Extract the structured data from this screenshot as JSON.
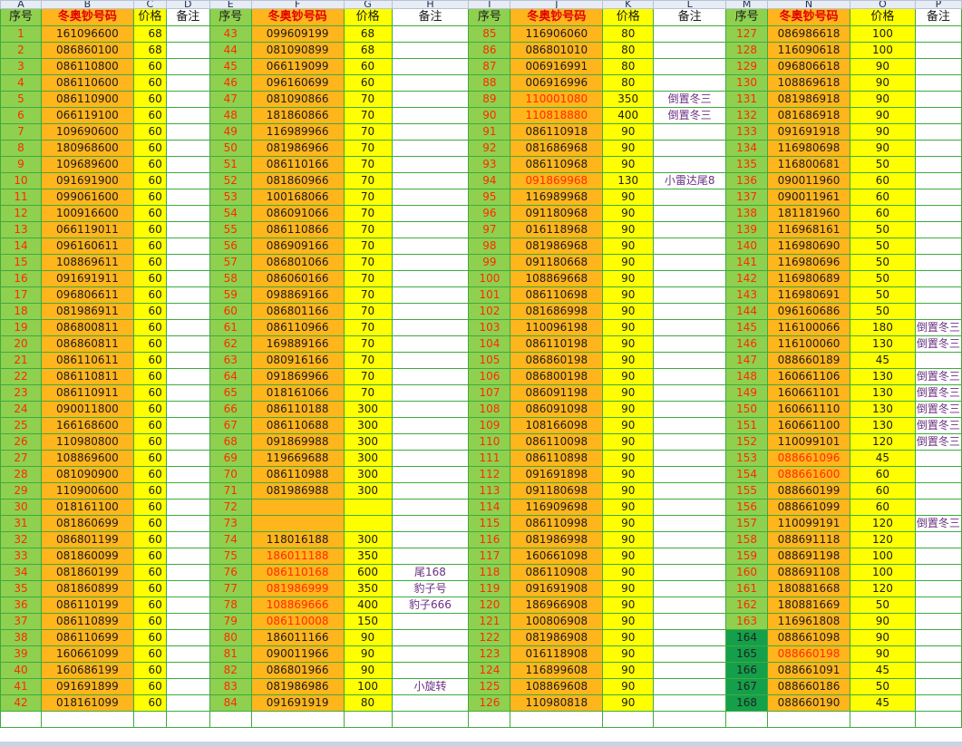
{
  "colors": {
    "seq": "#8fd04f",
    "code": "#ffb51c",
    "price": "#ffff00",
    "note": "#ffffff",
    "seq_dark": "#14a04a",
    "red_text": "#ff2a00",
    "purple_text": "#6a3080"
  },
  "column_letters": [
    "A",
    "B",
    "C",
    "D",
    "E",
    "F",
    "G",
    "H",
    "I",
    "J",
    "K",
    "L",
    "M",
    "N",
    "O",
    "P"
  ],
  "headers": [
    "序号",
    "冬奥钞号码",
    "价格",
    "备注",
    "序号",
    "冬奥钞号码",
    "价格",
    "备注",
    "序号",
    "冬奥钞号码",
    "价格",
    "备注",
    "序号",
    "冬奥钞号码",
    "价格",
    "备注"
  ],
  "rows": [
    [
      "1",
      "161096600",
      "68",
      "",
      "43",
      "099609199",
      "68",
      "",
      "85",
      "116906060",
      "80",
      "",
      "127",
      "086986618",
      "100",
      ""
    ],
    [
      "2",
      "086860100",
      "68",
      "",
      "44",
      "081090899",
      "68",
      "",
      "86",
      "086801010",
      "80",
      "",
      "128",
      "116090618",
      "100",
      ""
    ],
    [
      "3",
      "086110800",
      "60",
      "",
      "45",
      "066119099",
      "60",
      "",
      "87",
      "006916991",
      "80",
      "",
      "129",
      "096806618",
      "90",
      ""
    ],
    [
      "4",
      "086110600",
      "60",
      "",
      "46",
      "096160699",
      "60",
      "",
      "88",
      "006916996",
      "80",
      "",
      "130",
      "108869618",
      "90",
      ""
    ],
    [
      "5",
      "086110900",
      "60",
      "",
      "47",
      "081090866",
      "70",
      "",
      "89",
      "110001080",
      "350",
      "倒置冬三",
      "131",
      "081986918",
      "90",
      ""
    ],
    [
      "6",
      "066119100",
      "60",
      "",
      "48",
      "181860866",
      "70",
      "",
      "90",
      "110818880",
      "400",
      "倒置冬三",
      "132",
      "081686918",
      "90",
      ""
    ],
    [
      "7",
      "109690600",
      "60",
      "",
      "49",
      "116989966",
      "70",
      "",
      "91",
      "086110918",
      "90",
      "",
      "133",
      "091691918",
      "90",
      ""
    ],
    [
      "8",
      "180968600",
      "60",
      "",
      "50",
      "081986966",
      "70",
      "",
      "92",
      "081686968",
      "90",
      "",
      "134",
      "116980698",
      "90",
      ""
    ],
    [
      "9",
      "109689600",
      "60",
      "",
      "51",
      "086110166",
      "70",
      "",
      "93",
      "086110968",
      "90",
      "",
      "135",
      "116800681",
      "50",
      ""
    ],
    [
      "10",
      "091691900",
      "60",
      "",
      "52",
      "081860966",
      "70",
      "",
      "94",
      "091869968",
      "130",
      "小雷达尾8",
      "136",
      "090011960",
      "60",
      ""
    ],
    [
      "11",
      "099061600",
      "60",
      "",
      "53",
      "100168066",
      "70",
      "",
      "95",
      "116989968",
      "90",
      "",
      "137",
      "090011961",
      "60",
      ""
    ],
    [
      "12",
      "100916600",
      "60",
      "",
      "54",
      "086091066",
      "70",
      "",
      "96",
      "091180968",
      "90",
      "",
      "138",
      "181181960",
      "60",
      ""
    ],
    [
      "13",
      "066119011",
      "60",
      "",
      "55",
      "086110866",
      "70",
      "",
      "97",
      "016118968",
      "90",
      "",
      "139",
      "116968161",
      "50",
      ""
    ],
    [
      "14",
      "096160611",
      "60",
      "",
      "56",
      "086909166",
      "70",
      "",
      "98",
      "081986968",
      "90",
      "",
      "140",
      "116980690",
      "50",
      ""
    ],
    [
      "15",
      "108869611",
      "60",
      "",
      "57",
      "086801066",
      "70",
      "",
      "99",
      "091180668",
      "90",
      "",
      "141",
      "116980696",
      "50",
      ""
    ],
    [
      "16",
      "091691911",
      "60",
      "",
      "58",
      "086060166",
      "70",
      "",
      "100",
      "108869668",
      "90",
      "",
      "142",
      "116980689",
      "50",
      ""
    ],
    [
      "17",
      "096806611",
      "60",
      "",
      "59",
      "098869166",
      "70",
      "",
      "101",
      "086110698",
      "90",
      "",
      "143",
      "116980691",
      "50",
      ""
    ],
    [
      "18",
      "081986911",
      "60",
      "",
      "60",
      "086801166",
      "70",
      "",
      "102",
      "081686998",
      "90",
      "",
      "144",
      "096160686",
      "50",
      ""
    ],
    [
      "19",
      "086800811",
      "60",
      "",
      "61",
      "086110966",
      "70",
      "",
      "103",
      "110096198",
      "90",
      "",
      "145",
      "116100066",
      "180",
      "倒置冬三"
    ],
    [
      "20",
      "086860811",
      "60",
      "",
      "62",
      "169889166",
      "70",
      "",
      "104",
      "086110198",
      "90",
      "",
      "146",
      "116100060",
      "130",
      "倒置冬三"
    ],
    [
      "21",
      "086110611",
      "60",
      "",
      "63",
      "080916166",
      "70",
      "",
      "105",
      "086860198",
      "90",
      "",
      "147",
      "088660189",
      "45",
      ""
    ],
    [
      "22",
      "086110811",
      "60",
      "",
      "64",
      "091869966",
      "70",
      "",
      "106",
      "086800198",
      "90",
      "",
      "148",
      "160661106",
      "130",
      "倒置冬三"
    ],
    [
      "23",
      "086110911",
      "60",
      "",
      "65",
      "018161066",
      "70",
      "",
      "107",
      "086091198",
      "90",
      "",
      "149",
      "160661101",
      "130",
      "倒置冬三"
    ],
    [
      "24",
      "090011800",
      "60",
      "",
      "66",
      "086110188",
      "300",
      "",
      "108",
      "086091098",
      "90",
      "",
      "150",
      "160661110",
      "130",
      "倒置冬三"
    ],
    [
      "25",
      "166168600",
      "60",
      "",
      "67",
      "086110688",
      "300",
      "",
      "109",
      "108166098",
      "90",
      "",
      "151",
      "160661100",
      "130",
      "倒置冬三"
    ],
    [
      "26",
      "110980800",
      "60",
      "",
      "68",
      "091869988",
      "300",
      "",
      "110",
      "086110098",
      "90",
      "",
      "152",
      "110099101",
      "120",
      "倒置冬三"
    ],
    [
      "27",
      "108869600",
      "60",
      "",
      "69",
      "119669688",
      "300",
      "",
      "111",
      "086110898",
      "90",
      "",
      "153",
      "088661096",
      "45",
      ""
    ],
    [
      "28",
      "081090900",
      "60",
      "",
      "70",
      "086110988",
      "300",
      "",
      "112",
      "091691898",
      "90",
      "",
      "154",
      "088661600",
      "60",
      ""
    ],
    [
      "29",
      "110900600",
      "60",
      "",
      "71",
      "081986988",
      "300",
      "",
      "113",
      "091180698",
      "90",
      "",
      "155",
      "088660199",
      "60",
      ""
    ],
    [
      "30",
      "018161100",
      "60",
      "",
      "72",
      "",
      "",
      "",
      "114",
      "116909698",
      "90",
      "",
      "156",
      "088661099",
      "60",
      ""
    ],
    [
      "31",
      "081860699",
      "60",
      "",
      "73",
      "",
      "",
      "",
      "115",
      "086110998",
      "90",
      "",
      "157",
      "110099191",
      "120",
      "倒置冬三"
    ],
    [
      "32",
      "086801199",
      "60",
      "",
      "74",
      "118016188",
      "300",
      "",
      "116",
      "081986998",
      "90",
      "",
      "158",
      "088691118",
      "120",
      ""
    ],
    [
      "33",
      "081860099",
      "60",
      "",
      "75",
      "186011188",
      "350",
      "",
      "117",
      "160661098",
      "90",
      "",
      "159",
      "088691198",
      "100",
      ""
    ],
    [
      "34",
      "081860199",
      "60",
      "",
      "76",
      "086110168",
      "600",
      "尾168",
      "118",
      "086110908",
      "90",
      "",
      "160",
      "088691108",
      "100",
      ""
    ],
    [
      "35",
      "081860899",
      "60",
      "",
      "77",
      "081986999",
      "350",
      "豹子号",
      "119",
      "091691908",
      "90",
      "",
      "161",
      "180881668",
      "120",
      ""
    ],
    [
      "36",
      "086110199",
      "60",
      "",
      "78",
      "108869666",
      "400",
      "豹子666",
      "120",
      "186966908",
      "90",
      "",
      "162",
      "180881669",
      "50",
      ""
    ],
    [
      "37",
      "086110899",
      "60",
      "",
      "79",
      "086110008",
      "150",
      "",
      "121",
      "100806908",
      "90",
      "",
      "163",
      "116961808",
      "90",
      ""
    ],
    [
      "38",
      "086110699",
      "60",
      "",
      "80",
      "186011166",
      "90",
      "",
      "122",
      "081986908",
      "90",
      "",
      "164",
      "088661098",
      "90",
      ""
    ],
    [
      "39",
      "160661099",
      "60",
      "",
      "81",
      "090011966",
      "90",
      "",
      "123",
      "016118908",
      "90",
      "",
      "165",
      "088660198",
      "90",
      ""
    ],
    [
      "40",
      "160686199",
      "60",
      "",
      "82",
      "086801966",
      "90",
      "",
      "124",
      "116899608",
      "90",
      "",
      "166",
      "088661091",
      "45",
      ""
    ],
    [
      "41",
      "091691899",
      "60",
      "",
      "83",
      "081986986",
      "100",
      "小旋转",
      "125",
      "108869608",
      "90",
      "",
      "167",
      "088660186",
      "50",
      ""
    ],
    [
      "42",
      "018161099",
      "60",
      "",
      "84",
      "091691919",
      "80",
      "",
      "126",
      "110980818",
      "90",
      "",
      "168",
      "088660190",
      "45",
      ""
    ]
  ]
}
